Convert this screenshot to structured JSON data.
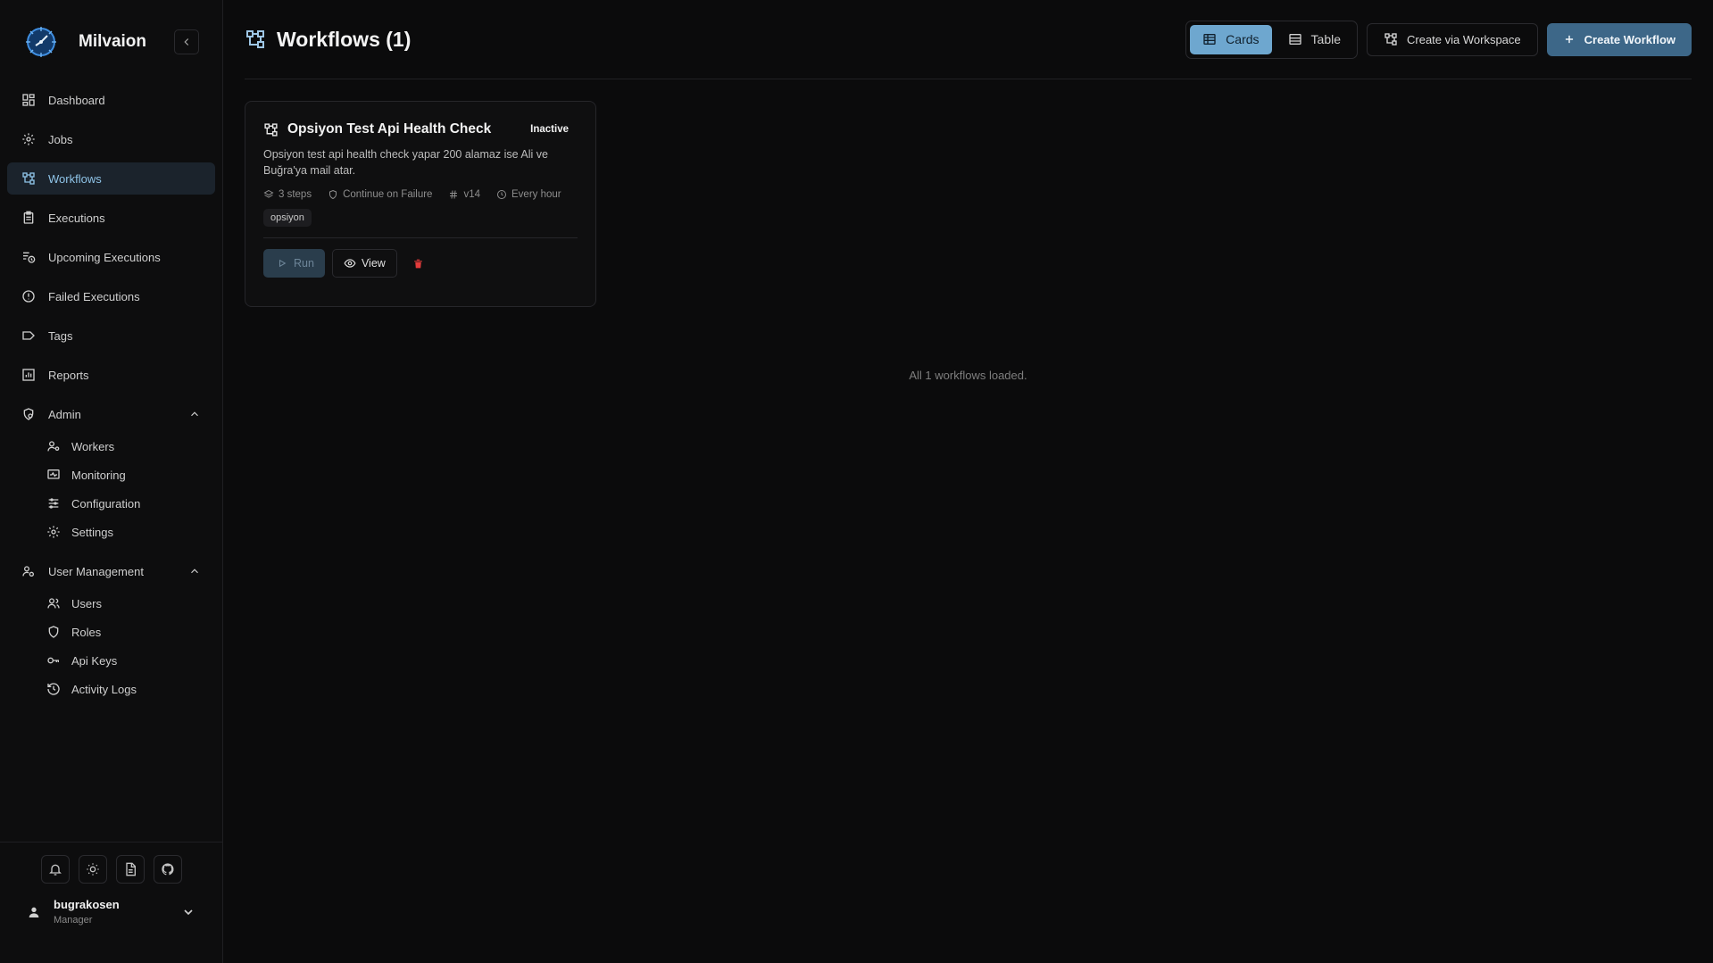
{
  "brand": {
    "name": "Milvaion"
  },
  "sidebar": {
    "items": [
      {
        "label": "Dashboard"
      },
      {
        "label": "Jobs"
      },
      {
        "label": "Workflows"
      },
      {
        "label": "Executions"
      },
      {
        "label": "Upcoming Executions"
      },
      {
        "label": "Failed Executions"
      },
      {
        "label": "Tags"
      },
      {
        "label": "Reports"
      }
    ],
    "admin": {
      "label": "Admin",
      "items": [
        {
          "label": "Workers"
        },
        {
          "label": "Monitoring"
        },
        {
          "label": "Configuration"
        },
        {
          "label": "Settings"
        }
      ]
    },
    "user_management": {
      "label": "User Management",
      "items": [
        {
          "label": "Users"
        },
        {
          "label": "Roles"
        },
        {
          "label": "Api Keys"
        },
        {
          "label": "Activity Logs"
        }
      ]
    }
  },
  "user": {
    "name": "bugrakosen",
    "role": "Manager"
  },
  "header": {
    "title": "Workflows (1)",
    "toggle": {
      "cards": "Cards",
      "table": "Table",
      "active": "cards"
    },
    "create_workspace": "Create via Workspace",
    "create_workflow": "Create Workflow"
  },
  "workflows": [
    {
      "title": "Opsiyon Test Api Health Check",
      "status": "Inactive",
      "description": "Opsiyon test api health check yapar 200 alamaz ise Ali ve Buğra'ya mail atar.",
      "steps": "3 steps",
      "failure_mode": "Continue on Failure",
      "version": "v14",
      "schedule": "Every hour",
      "tag": "opsiyon",
      "run_label": "Run",
      "view_label": "View"
    }
  ],
  "footer_note": "All 1 workflows loaded.",
  "colors": {
    "accent": "#6ea7cf",
    "primary": "#3d6788",
    "danger": "#e23b3b",
    "background": "#0b0b0c"
  }
}
